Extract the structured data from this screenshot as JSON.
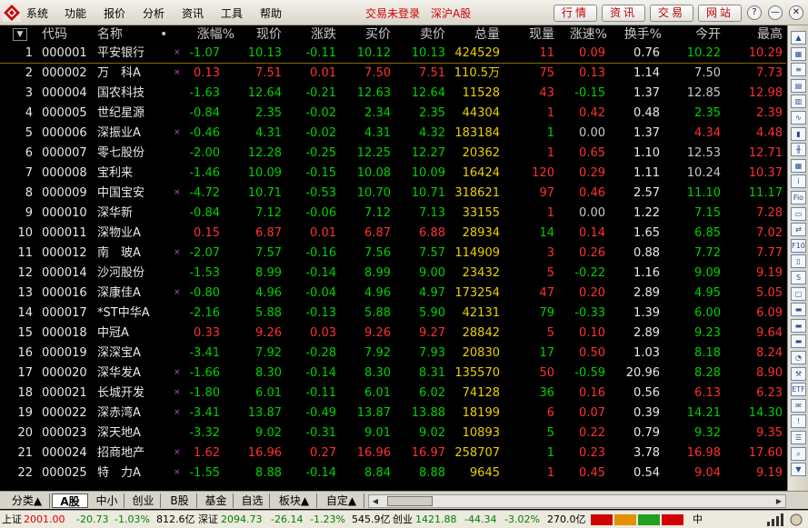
{
  "menu": {
    "items": [
      "系统",
      "功能",
      "报价",
      "分析",
      "资讯",
      "工具",
      "帮助"
    ],
    "login_status": "交易未登录",
    "market": "深沪A股",
    "nav_buttons": [
      "行情",
      "资讯",
      "交易",
      "网站"
    ],
    "window_buttons": [
      "?",
      "—",
      "✕"
    ]
  },
  "columns": [
    "代码",
    "名称",
    "•",
    "涨幅%",
    "现价",
    "涨跌",
    "买价",
    "卖价",
    "总量",
    "现量",
    "涨速%",
    "换手%",
    "今开",
    "最高"
  ],
  "rows": [
    {
      "n": "1",
      "code": "000001",
      "name": "平安银行",
      "mark": "×",
      "chg": "-1.07",
      "price": "10.13",
      "diff": "-0.11",
      "bid": "10.12",
      "ask": "10.13",
      "vol": "424529",
      "cur": "11",
      "spd": "0.09",
      "turn": "0.76",
      "open": "10.22",
      "high": "10.29",
      "up": false,
      "pc": "#00d000",
      "oc": "#00d000",
      "hc": "#ff3030",
      "cc": "#ff3030",
      "sc": "#ff3030"
    },
    {
      "n": "2",
      "code": "000002",
      "name": "万　科A",
      "mark": "×",
      "chg": "0.13",
      "price": "7.51",
      "diff": "0.01",
      "bid": "7.50",
      "ask": "7.51",
      "vol": "110.5万",
      "cur": "75",
      "spd": "0.13",
      "turn": "1.14",
      "open": "7.50",
      "high": "7.73",
      "up": true,
      "pc": "#ff3030",
      "oc": "#c8c8c8",
      "hc": "#ff3030",
      "cc": "#ff3030",
      "sc": "#ff3030"
    },
    {
      "n": "3",
      "code": "000004",
      "name": "国农科技",
      "mark": "",
      "chg": "-1.63",
      "price": "12.64",
      "diff": "-0.21",
      "bid": "12.63",
      "ask": "12.64",
      "vol": "11528",
      "cur": "43",
      "spd": "-0.15",
      "turn": "1.37",
      "open": "12.85",
      "high": "12.98",
      "up": false,
      "pc": "#00d000",
      "oc": "#c8c8c8",
      "hc": "#ff3030",
      "cc": "#ff3030",
      "sc": "#00d000"
    },
    {
      "n": "4",
      "code": "000005",
      "name": "世纪星源",
      "mark": "",
      "chg": "-0.84",
      "price": "2.35",
      "diff": "-0.02",
      "bid": "2.34",
      "ask": "2.35",
      "vol": "44304",
      "cur": "1",
      "spd": "0.42",
      "turn": "0.48",
      "open": "2.35",
      "high": "2.39",
      "up": false,
      "pc": "#00d000",
      "oc": "#00d000",
      "hc": "#ff3030",
      "cc": "#ff3030",
      "sc": "#ff3030"
    },
    {
      "n": "5",
      "code": "000006",
      "name": "深振业A",
      "mark": "×",
      "chg": "-0.46",
      "price": "4.31",
      "diff": "-0.02",
      "bid": "4.31",
      "ask": "4.32",
      "vol": "183184",
      "cur": "1",
      "spd": "0.00",
      "turn": "1.37",
      "open": "4.34",
      "high": "4.48",
      "up": false,
      "pc": "#00d000",
      "oc": "#ff3030",
      "hc": "#ff3030",
      "cc": "#00d000",
      "sc": "#c8c8c8"
    },
    {
      "n": "6",
      "code": "000007",
      "name": "零七股份",
      "mark": "",
      "chg": "-2.00",
      "price": "12.28",
      "diff": "-0.25",
      "bid": "12.25",
      "ask": "12.27",
      "vol": "20362",
      "cur": "1",
      "spd": "0.65",
      "turn": "1.10",
      "open": "12.53",
      "high": "12.71",
      "up": false,
      "pc": "#00d000",
      "oc": "#c8c8c8",
      "hc": "#ff3030",
      "cc": "#ff3030",
      "sc": "#ff3030"
    },
    {
      "n": "7",
      "code": "000008",
      "name": "宝利来",
      "mark": "",
      "chg": "-1.46",
      "price": "10.09",
      "diff": "-0.15",
      "bid": "10.08",
      "ask": "10.09",
      "vol": "16424",
      "cur": "120",
      "spd": "0.29",
      "turn": "1.11",
      "open": "10.24",
      "high": "10.37",
      "up": false,
      "pc": "#00d000",
      "oc": "#c8c8c8",
      "hc": "#ff3030",
      "cc": "#ff3030",
      "sc": "#ff3030"
    },
    {
      "n": "8",
      "code": "000009",
      "name": "中国宝安",
      "mark": "×",
      "chg": "-4.72",
      "price": "10.71",
      "diff": "-0.53",
      "bid": "10.70",
      "ask": "10.71",
      "vol": "318621",
      "cur": "97",
      "spd": "0.46",
      "turn": "2.57",
      "open": "11.10",
      "high": "11.17",
      "up": false,
      "pc": "#00d000",
      "oc": "#00d000",
      "hc": "#00d000",
      "cc": "#ff3030",
      "sc": "#ff3030"
    },
    {
      "n": "9",
      "code": "000010",
      "name": "深华新",
      "mark": "",
      "chg": "-0.84",
      "price": "7.12",
      "diff": "-0.06",
      "bid": "7.12",
      "ask": "7.13",
      "vol": "33155",
      "cur": "1",
      "spd": "0.00",
      "turn": "1.22",
      "open": "7.15",
      "high": "7.28",
      "up": false,
      "pc": "#00d000",
      "oc": "#00d000",
      "hc": "#ff3030",
      "cc": "#ff3030",
      "sc": "#c8c8c8"
    },
    {
      "n": "10",
      "code": "000011",
      "name": "深物业A",
      "mark": "",
      "chg": "0.15",
      "price": "6.87",
      "diff": "0.01",
      "bid": "6.87",
      "ask": "6.88",
      "vol": "28934",
      "cur": "14",
      "spd": "0.14",
      "turn": "1.65",
      "open": "6.85",
      "high": "7.02",
      "up": true,
      "pc": "#ff3030",
      "oc": "#00d000",
      "hc": "#ff3030",
      "cc": "#00d000",
      "sc": "#ff3030"
    },
    {
      "n": "11",
      "code": "000012",
      "name": "南　玻A",
      "mark": "×",
      "chg": "-2.07",
      "price": "7.57",
      "diff": "-0.16",
      "bid": "7.56",
      "ask": "7.57",
      "vol": "114909",
      "cur": "3",
      "spd": "0.26",
      "turn": "0.88",
      "open": "7.72",
      "high": "7.77",
      "up": false,
      "pc": "#00d000",
      "oc": "#00d000",
      "hc": "#ff3030",
      "cc": "#ff3030",
      "sc": "#ff3030"
    },
    {
      "n": "12",
      "code": "000014",
      "name": "沙河股份",
      "mark": "",
      "chg": "-1.53",
      "price": "8.99",
      "diff": "-0.14",
      "bid": "8.99",
      "ask": "9.00",
      "vol": "23432",
      "cur": "5",
      "spd": "-0.22",
      "turn": "1.16",
      "open": "9.09",
      "high": "9.19",
      "up": false,
      "pc": "#00d000",
      "oc": "#00d000",
      "hc": "#ff3030",
      "cc": "#ff3030",
      "sc": "#00d000"
    },
    {
      "n": "13",
      "code": "000016",
      "name": "深康佳A",
      "mark": "×",
      "chg": "-0.80",
      "price": "4.96",
      "diff": "-0.04",
      "bid": "4.96",
      "ask": "4.97",
      "vol": "173254",
      "cur": "47",
      "spd": "0.20",
      "turn": "2.89",
      "open": "4.95",
      "high": "5.05",
      "up": false,
      "pc": "#00d000",
      "oc": "#00d000",
      "hc": "#ff3030",
      "cc": "#ff3030",
      "sc": "#ff3030"
    },
    {
      "n": "14",
      "code": "000017",
      "name": "*ST中华A",
      "mark": "",
      "chg": "-2.16",
      "price": "5.88",
      "diff": "-0.13",
      "bid": "5.88",
      "ask": "5.90",
      "vol": "42131",
      "cur": "79",
      "spd": "-0.33",
      "turn": "1.39",
      "open": "6.00",
      "high": "6.09",
      "up": false,
      "pc": "#00d000",
      "oc": "#00d000",
      "hc": "#ff3030",
      "cc": "#00d000",
      "sc": "#00d000"
    },
    {
      "n": "15",
      "code": "000018",
      "name": "中冠A",
      "mark": "",
      "chg": "0.33",
      "price": "9.26",
      "diff": "0.03",
      "bid": "9.26",
      "ask": "9.27",
      "vol": "28842",
      "cur": "5",
      "spd": "0.10",
      "turn": "2.89",
      "open": "9.23",
      "high": "9.64",
      "up": true,
      "pc": "#ff3030",
      "oc": "#00d000",
      "hc": "#ff3030",
      "cc": "#ff3030",
      "sc": "#ff3030"
    },
    {
      "n": "16",
      "code": "000019",
      "name": "深深宝A",
      "mark": "",
      "chg": "-3.41",
      "price": "7.92",
      "diff": "-0.28",
      "bid": "7.92",
      "ask": "7.93",
      "vol": "20830",
      "cur": "17",
      "spd": "0.50",
      "turn": "1.03",
      "open": "8.18",
      "high": "8.24",
      "up": false,
      "pc": "#00d000",
      "oc": "#00d000",
      "hc": "#ff3030",
      "cc": "#00d000",
      "sc": "#ff3030"
    },
    {
      "n": "17",
      "code": "000020",
      "name": "深华发A",
      "mark": "×",
      "chg": "-1.66",
      "price": "8.30",
      "diff": "-0.14",
      "bid": "8.30",
      "ask": "8.31",
      "vol": "135570",
      "cur": "50",
      "spd": "-0.59",
      "turn": "20.96",
      "open": "8.28",
      "high": "8.90",
      "up": false,
      "pc": "#00d000",
      "oc": "#00d000",
      "hc": "#ff3030",
      "cc": "#ff3030",
      "sc": "#00d000"
    },
    {
      "n": "18",
      "code": "000021",
      "name": "长城开发",
      "mark": "×",
      "chg": "-1.80",
      "price": "6.01",
      "diff": "-0.11",
      "bid": "6.01",
      "ask": "6.02",
      "vol": "74128",
      "cur": "36",
      "spd": "0.16",
      "turn": "0.56",
      "open": "6.13",
      "high": "6.23",
      "up": false,
      "pc": "#00d000",
      "oc": "#ff3030",
      "hc": "#ff3030",
      "cc": "#00d000",
      "sc": "#ff3030"
    },
    {
      "n": "19",
      "code": "000022",
      "name": "深赤湾A",
      "mark": "×",
      "chg": "-3.41",
      "price": "13.87",
      "diff": "-0.49",
      "bid": "13.87",
      "ask": "13.88",
      "vol": "18199",
      "cur": "6",
      "spd": "0.07",
      "turn": "0.39",
      "open": "14.21",
      "high": "14.30",
      "up": false,
      "pc": "#00d000",
      "oc": "#00d000",
      "hc": "#00d000",
      "cc": "#ff3030",
      "sc": "#ff3030"
    },
    {
      "n": "20",
      "code": "000023",
      "name": "深天地A",
      "mark": "",
      "chg": "-3.32",
      "price": "9.02",
      "diff": "-0.31",
      "bid": "9.01",
      "ask": "9.02",
      "vol": "10893",
      "cur": "5",
      "spd": "0.22",
      "turn": "0.79",
      "open": "9.32",
      "high": "9.35",
      "up": false,
      "pc": "#00d000",
      "oc": "#00d000",
      "hc": "#ff3030",
      "cc": "#00d000",
      "sc": "#ff3030"
    },
    {
      "n": "21",
      "code": "000024",
      "name": "招商地产",
      "mark": "×",
      "chg": "1.62",
      "price": "16.96",
      "diff": "0.27",
      "bid": "16.96",
      "ask": "16.97",
      "vol": "258707",
      "cur": "1",
      "spd": "0.23",
      "turn": "3.78",
      "open": "16.98",
      "high": "17.60",
      "up": true,
      "pc": "#ff3030",
      "oc": "#ff3030",
      "hc": "#ff3030",
      "cc": "#00d000",
      "sc": "#ff3030"
    },
    {
      "n": "22",
      "code": "000025",
      "name": "特　力A",
      "mark": "×",
      "chg": "-1.55",
      "price": "8.88",
      "diff": "-0.14",
      "bid": "8.84",
      "ask": "8.88",
      "vol": "9645",
      "cur": "1",
      "spd": "0.45",
      "turn": "0.54",
      "open": "9.04",
      "high": "9.19",
      "up": false,
      "pc": "#00d000",
      "oc": "#ff3030",
      "hc": "#ff3030",
      "cc": "#ff3030",
      "sc": "#ff3030"
    }
  ],
  "tabs": [
    "分类▲",
    "A股",
    "中小",
    "创业",
    "B股",
    "基金",
    "自选",
    "板块▲",
    "自定▲"
  ],
  "active_tab": "A股",
  "status": {
    "sh_label": "上证",
    "sh_index": "2001.00",
    "sh_chg": "-20.73",
    "sh_pct": "-1.03%",
    "sh_amt": "812.6亿",
    "sz_label": "深证",
    "sz_index": "2094.73",
    "sz_chg": "-26.14",
    "sz_pct": "-1.23%",
    "sz_amt": "545.9亿",
    "cy_label": "创业",
    "cy_index": "1421.88",
    "cy_chg": "-44.34",
    "cy_pct": "-3.02%",
    "cy_amt": "270.0亿",
    "indicator": "中"
  },
  "toolbar_icons": [
    "scroll-up-icon",
    "grid-icon",
    "list-icon",
    "book-icon",
    "report-icon",
    "chart-icon",
    "bar-chart-icon",
    "kline-icon",
    "table-icon",
    "info-icon",
    "fio-icon",
    "page-icon",
    "flow-icon",
    "f10-icon",
    "tick-icon",
    "sql-icon",
    "window-icon",
    "folder-icon",
    "folder2-icon",
    "folder3-icon",
    "dial-icon",
    "tools-icon",
    "etf-icon",
    "news-icon",
    "alert-icon",
    "rank-icon",
    "find-icon",
    "scroll-down-icon"
  ]
}
